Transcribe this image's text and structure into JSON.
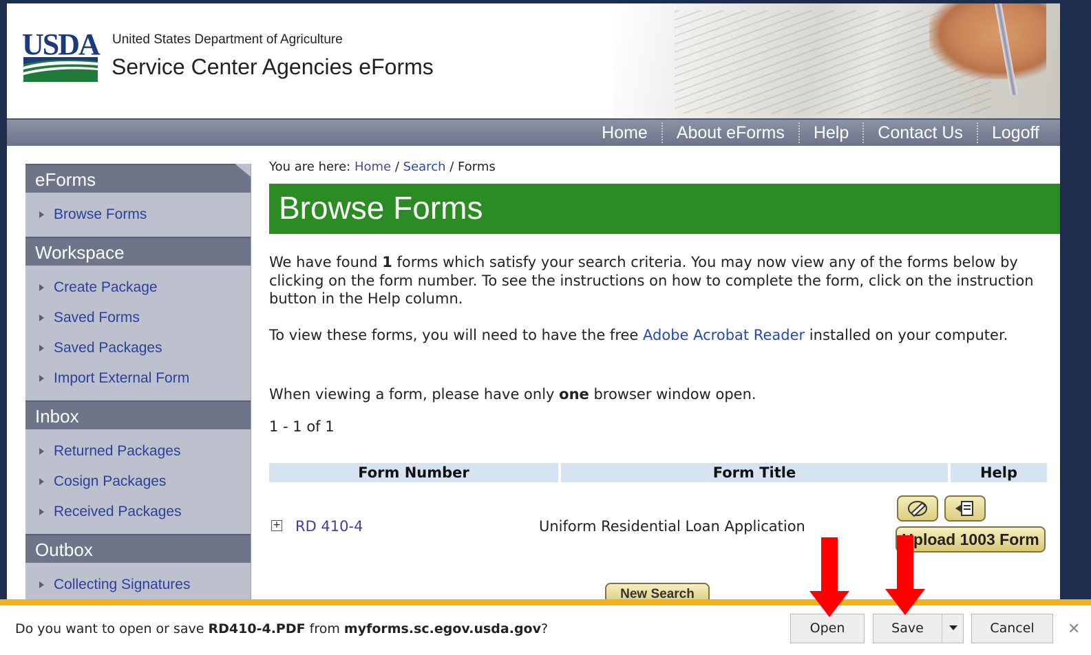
{
  "header": {
    "logo_text": "USDA",
    "department": "United States Department of Agriculture",
    "app_name": "Service Center Agencies eForms"
  },
  "nav": {
    "items": [
      "Home",
      "About eForms",
      "Help",
      "Contact Us",
      "Logoff"
    ]
  },
  "sidebar": {
    "sections": [
      {
        "title": "eForms",
        "items": [
          "Browse Forms"
        ]
      },
      {
        "title": "Workspace",
        "items": [
          "Create Package",
          "Saved Forms",
          "Saved Packages",
          "Import External Form"
        ]
      },
      {
        "title": "Inbox",
        "items": [
          "Returned Packages",
          "Cosign Packages",
          "Received Packages"
        ]
      },
      {
        "title": "Outbox",
        "items": [
          "Collecting Signatures"
        ]
      }
    ]
  },
  "breadcrumb": {
    "prefix": "You are here:",
    "home": "Home",
    "sep1": "/",
    "search": "Search",
    "sep2": "/",
    "current": "Forms"
  },
  "main": {
    "title": "Browse Forms",
    "para1_a": "We have found ",
    "para1_count": "1",
    "para1_b": " forms which satisfy your search criteria.  You may now view any of the forms below by clicking on the form number.  To see the instructions on how to complete the form, click on the instruction button in the Help column.",
    "para2_a": "To view these forms, you will need to have the free ",
    "para2_link": "Adobe Acrobat Reader",
    "para2_b": " installed on your computer.",
    "para3_a": "When viewing a form, please have only ",
    "para3_bold": "one",
    "para3_b": " browser window open.",
    "results_count": "1 - 1 of 1"
  },
  "table": {
    "headers": [
      "Form Number",
      "Form Title",
      "Help"
    ],
    "rows": [
      {
        "expand": "+",
        "form_number": "RD 410-4",
        "form_title": "Uniform Residential Loan Application"
      }
    ],
    "upload_label": "Upload 1003 Form",
    "new_search_label": "New Search"
  },
  "download_bar": {
    "prompt_a": "Do you want to open or save ",
    "file_name": "RD410-4.PDF",
    "prompt_b": " from ",
    "source": "myforms.sc.egov.usda.gov",
    "prompt_c": "?",
    "open_label": "Open",
    "save_label": "Save",
    "cancel_label": "Cancel",
    "close_glyph": "✕"
  },
  "colors": {
    "title_green": "#2c8c24",
    "nav_gray": "#7a8196",
    "sidebar_bg": "#bcc1cd",
    "link_blue": "#2548b5",
    "notification_accent": "#f2b21c",
    "annotation_red": "#ff0000"
  }
}
